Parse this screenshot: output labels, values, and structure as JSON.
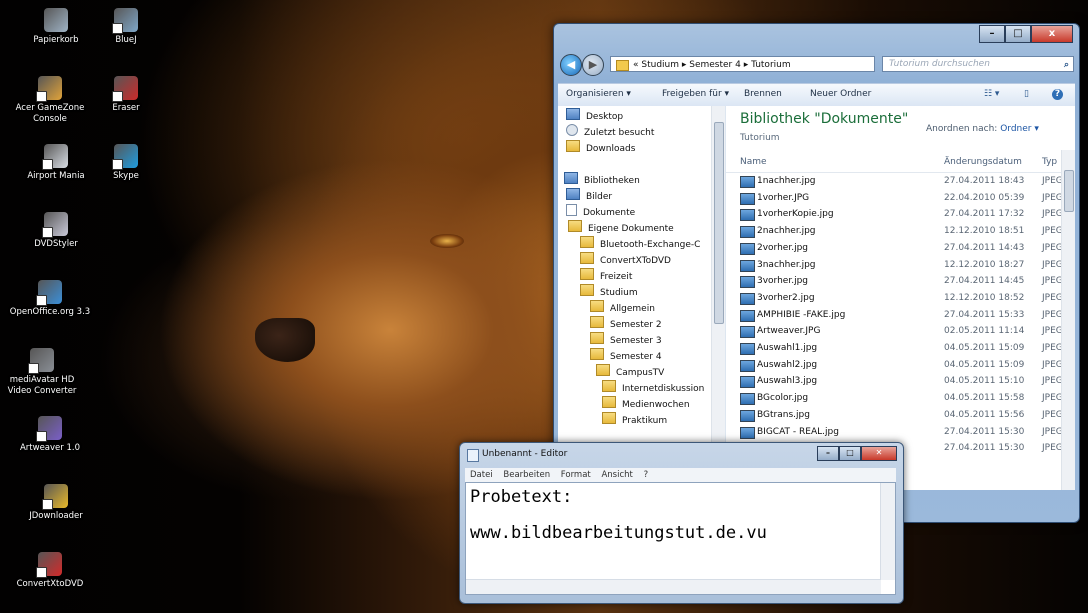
{
  "desktop": {
    "icons": [
      {
        "label": "Papierkorb",
        "icon": "recycle-bin-icon",
        "color": "#9fb4c6"
      },
      {
        "label": "BlueJ",
        "icon": "bluej-icon",
        "color": "#7fa7c8"
      },
      {
        "label": "Acer GameZone Console",
        "icon": "gamezone-icon",
        "color": "#e0a33a"
      },
      {
        "label": "Eraser",
        "icon": "eraser-icon",
        "color": "#cc2a2a"
      },
      {
        "label": "Airport Mania",
        "icon": "airport-mania-icon",
        "color": "#d8dde4"
      },
      {
        "label": "Skype",
        "icon": "skype-icon",
        "color": "#1f9de0"
      },
      {
        "label": "DVDStyler",
        "icon": "dvdstyler-icon",
        "color": "#c9c9d8"
      },
      {
        "label": "OpenOffice.org 3.3",
        "icon": "openoffice-icon",
        "color": "#3b8fd8"
      },
      {
        "label": "mediAvatar HD Video Converter",
        "icon": "video-converter-icon",
        "color": "#8a8f96"
      },
      {
        "label": "Artweaver 1.0",
        "icon": "artweaver-icon",
        "color": "#7a5fc8"
      },
      {
        "label": "JDownloader",
        "icon": "jdownloader-icon",
        "color": "#e8b92a"
      },
      {
        "label": "ConvertXtoDVD",
        "icon": "convertxtodvd-icon",
        "color": "#d22a2a"
      }
    ]
  },
  "explorer": {
    "window_controls": {
      "minimize": "–",
      "maximize": "□",
      "close": "x"
    },
    "address": "« Studium ▸ Semester 4 ▸ Tutorium",
    "search_placeholder": "Tutorium durchsuchen",
    "toolbar": {
      "organize": "Organisieren ▾",
      "share": "Freigeben für ▾",
      "burn": "Brennen",
      "new_folder": "Neuer Ordner"
    },
    "nav": [
      {
        "label": "Desktop",
        "kind": "lib"
      },
      {
        "label": "Zuletzt besucht",
        "kind": "clock"
      },
      {
        "label": "Downloads",
        "kind": "folder"
      },
      {
        "label": "Bibliotheken",
        "kind": "lib"
      },
      {
        "label": "Bilder",
        "kind": "lib"
      },
      {
        "label": "Dokumente",
        "kind": "doc"
      },
      {
        "label": "Eigene Dokumente",
        "kind": "folder"
      },
      {
        "label": "Bluetooth-Exchange-C",
        "kind": "folder"
      },
      {
        "label": "ConvertXToDVD",
        "kind": "folder"
      },
      {
        "label": "Freizeit",
        "kind": "folder"
      },
      {
        "label": "Studium",
        "kind": "folder"
      },
      {
        "label": "Allgemein",
        "kind": "folder"
      },
      {
        "label": "Semester 2",
        "kind": "folder"
      },
      {
        "label": "Semester 3",
        "kind": "folder"
      },
      {
        "label": "Semester 4",
        "kind": "folder"
      },
      {
        "label": "CampusTV",
        "kind": "folder"
      },
      {
        "label": "Internetdiskussion",
        "kind": "folder"
      },
      {
        "label": "Medienwochen",
        "kind": "folder"
      },
      {
        "label": "Praktikum",
        "kind": "folder"
      }
    ],
    "library_title": "Bibliothek \"Dokumente\"",
    "library_subtitle": "Tutorium",
    "arrange_label": "Anordnen nach:",
    "arrange_value": "Ordner ▾",
    "columns": {
      "name": "Name",
      "date": "Änderungsdatum",
      "type": "Typ"
    },
    "files": [
      {
        "name": "1nachher.jpg",
        "date": "27.04.2011 18:43",
        "type": "JPEG"
      },
      {
        "name": "1vorher.JPG",
        "date": "22.04.2010 05:39",
        "type": "JPEG"
      },
      {
        "name": "1vorherKopie.jpg",
        "date": "27.04.2011 17:32",
        "type": "JPEG"
      },
      {
        "name": "2nachher.jpg",
        "date": "12.12.2010 18:51",
        "type": "JPEG"
      },
      {
        "name": "2vorher.jpg",
        "date": "27.04.2011 14:43",
        "type": "JPEG"
      },
      {
        "name": "3nachher.jpg",
        "date": "12.12.2010 18:27",
        "type": "JPEG"
      },
      {
        "name": "3vorher.jpg",
        "date": "27.04.2011 14:45",
        "type": "JPEG"
      },
      {
        "name": "3vorher2.jpg",
        "date": "12.12.2010 18:52",
        "type": "JPEG"
      },
      {
        "name": "AMPHIBIE -FAKE.jpg",
        "date": "27.04.2011 15:33",
        "type": "JPEG"
      },
      {
        "name": "Artweaver.JPG",
        "date": "02.05.2011 11:14",
        "type": "JPEG"
      },
      {
        "name": "Auswahl1.jpg",
        "date": "04.05.2011 15:09",
        "type": "JPEG"
      },
      {
        "name": "Auswahl2.jpg",
        "date": "04.05.2011 15:09",
        "type": "JPEG"
      },
      {
        "name": "Auswahl3.jpg",
        "date": "04.05.2011 15:10",
        "type": "JPEG"
      },
      {
        "name": "BGcolor.jpg",
        "date": "04.05.2011 15:58",
        "type": "JPEG"
      },
      {
        "name": "BGtrans.jpg",
        "date": "04.05.2011 15:56",
        "type": "JPEG"
      },
      {
        "name": "BIGCAT - REAL.jpg",
        "date": "27.04.2011 15:30",
        "type": "JPEG"
      },
      {
        "name": "",
        "date": "27.04.2011 15:30",
        "type": "JPEG"
      }
    ]
  },
  "notepad": {
    "title": "Unbenannt - Editor",
    "menu": [
      "Datei",
      "Bearbeiten",
      "Format",
      "Ansicht",
      "?"
    ],
    "line1": "Probetext:",
    "line2": "www.bildbearbeitungstut.de.vu",
    "controls": {
      "minimize": "–",
      "maximize": "□",
      "close": "✕"
    }
  }
}
